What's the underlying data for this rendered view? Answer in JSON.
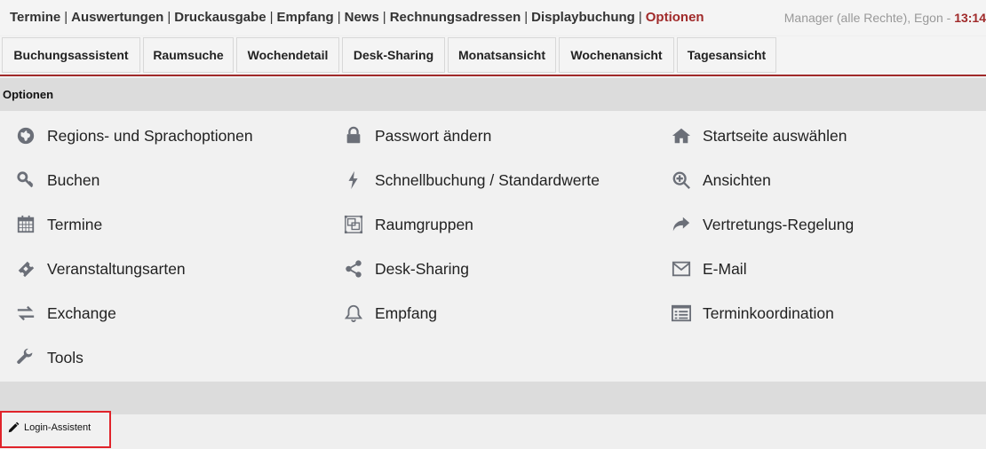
{
  "nav": {
    "items": [
      "Termine",
      "Auswertungen",
      "Druckausgabe",
      "Empfang",
      "News",
      "Rechnungsadressen",
      "Displaybuchung"
    ],
    "active": "Optionen",
    "separator": "|"
  },
  "user": {
    "label": "Manager (alle Rechte), Egon - ",
    "time": "13:14"
  },
  "tabs": [
    "Buchungsassistent",
    "Raumsuche",
    "Wochendetail",
    "Desk-Sharing",
    "Monatsansicht",
    "Wochenansicht",
    "Tagesansicht"
  ],
  "section": {
    "title": "Optionen"
  },
  "options": {
    "col1": [
      {
        "label": "Regions- und Sprachoptionen",
        "icon": "globe-icon"
      },
      {
        "label": "Buchen",
        "icon": "key-icon"
      },
      {
        "label": "Termine",
        "icon": "calendar-icon"
      },
      {
        "label": "Veranstaltungsarten",
        "icon": "ticket-icon"
      },
      {
        "label": "Exchange",
        "icon": "exchange-icon"
      },
      {
        "label": "Tools",
        "icon": "wrench-icon"
      }
    ],
    "col2": [
      {
        "label": "Passwort ändern",
        "icon": "lock-icon"
      },
      {
        "label": "Schnellbuchung / Standardwerte",
        "icon": "bolt-icon"
      },
      {
        "label": "Raumgruppen",
        "icon": "object-group-icon"
      },
      {
        "label": "Desk-Sharing",
        "icon": "share-icon"
      },
      {
        "label": "Empfang",
        "icon": "bell-icon"
      }
    ],
    "col3": [
      {
        "label": "Startseite auswählen",
        "icon": "home-icon"
      },
      {
        "label": "Ansichten",
        "icon": "zoom-in-icon"
      },
      {
        "label": "Vertretungs-Regelung",
        "icon": "share-arrow-icon"
      },
      {
        "label": "E-Mail",
        "icon": "envelope-icon"
      },
      {
        "label": "Terminkoordination",
        "icon": "list-alt-icon"
      }
    ]
  },
  "footer": {
    "login_label": "Login-Assistent"
  },
  "colors": {
    "accent": "#a02a2a",
    "icon": "#6b6f78",
    "highlight": "#e0232a"
  }
}
